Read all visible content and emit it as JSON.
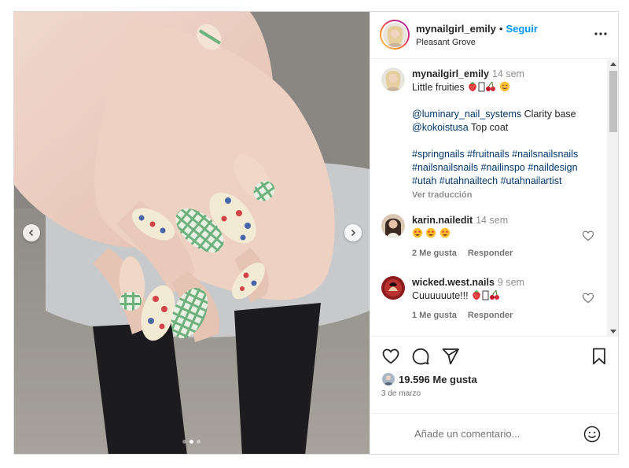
{
  "post": {
    "author": {
      "username": "mynailgirl_emily",
      "separator": "•",
      "follow_label": "Seguir",
      "location": "Pleasant Grove"
    },
    "more_icon": "more-horizontal-icon",
    "carousel": {
      "slide_count": 3,
      "active_index": 1,
      "prev_icon": "chevron-left-icon",
      "next_icon": "chevron-right-icon"
    },
    "caption": {
      "username": "mynailgirl_emily",
      "time": "14 sem",
      "line1": "Little fruities",
      "line1_emojis": [
        "strawberry",
        "tofu",
        "cherries",
        "smiling-face"
      ],
      "mention1": "@luminary_nail_systems",
      "mention1_text": "Clarity base",
      "mention2": "@kokoistusa",
      "mention2_text": "Top coat",
      "hashtags": [
        "#springnails #fruitnails #nailsnailsnails",
        "#nailsnailsnails #nailinspo #naildesign",
        "#utah #utahnailtech #utahnailartist"
      ],
      "translate_label": "Ver traducción"
    },
    "comments": [
      {
        "username": "karin.nailedit",
        "time": "14 sem",
        "text": "",
        "emojis": [
          "star-struck",
          "star-struck",
          "star-struck"
        ],
        "likes": "2 Me gusta",
        "reply": "Responder"
      },
      {
        "username": "wicked.west.nails",
        "time": "9 sem",
        "text": "Cuuuuuute!!!",
        "emojis": [
          "strawberry",
          "tofu",
          "cherries"
        ],
        "likes": "1 Me gusta",
        "reply": "Responder"
      }
    ],
    "actions": {
      "like_icon": "heart-icon",
      "comment_icon": "comment-icon",
      "share_icon": "send-icon",
      "save_icon": "bookmark-icon"
    },
    "likes_count": "19.596 Me gusta",
    "date": "3 de marzo",
    "add_comment_placeholder": "Añade un comentario...",
    "emoji_icon": "smiley-icon"
  },
  "colors": {
    "accent": "#0095f6",
    "link": "#00376b",
    "muted": "#8e8e8e",
    "border": "#efefef",
    "nail_green": "#6fb07f",
    "nail_cream": "#f3ead4"
  }
}
